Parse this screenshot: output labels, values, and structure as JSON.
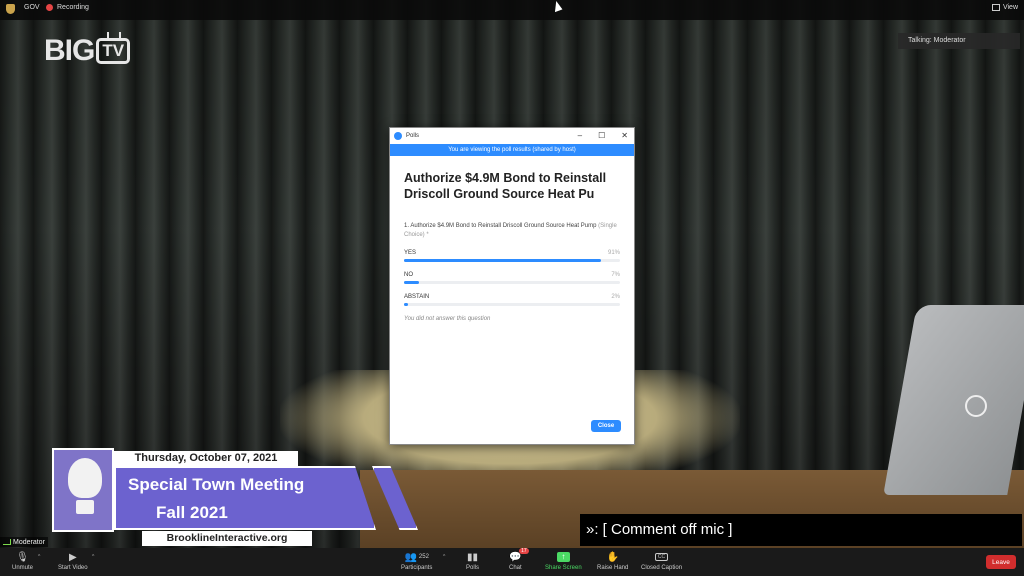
{
  "topbar": {
    "gov_label": "GOV",
    "recording_label": "Recording",
    "view_label": "View"
  },
  "logo": {
    "big": "BIG",
    "tv": "TV"
  },
  "talking": "Talking: Moderator",
  "poll": {
    "window_title": "Polls",
    "banner": "You are viewing the poll results (shared by host)",
    "title": "Authorize $4.9M Bond to Reinstall Driscoll Ground Source Heat Pu",
    "question": "1. Authorize $4.9M Bond to Reinstall Driscoll Ground Source Heat Pump",
    "question_type": "(Single Choice) *",
    "options": [
      {
        "label": "YES",
        "percent_label": "91%",
        "percent": 91
      },
      {
        "label": "NO",
        "percent_label": "7%",
        "percent": 7
      },
      {
        "label": "ABSTAIN",
        "percent_label": "2%",
        "percent": 2
      }
    ],
    "no_answer": "You did not answer this question",
    "close_label": "Close",
    "accent_color": "#2d8cff"
  },
  "lower_third": {
    "date": "Thursday, October 07, 2021",
    "title_line1": "Special Town Meeting",
    "title_line2": "Fall 2021",
    "url": "BrooklineInteractive.org",
    "accent_color": "#6c62cf"
  },
  "caption": "»:  [ Comment off mic ]",
  "speaker_tag": "Moderator",
  "toolbar": {
    "unmute": "Unmute",
    "start_video": "Start Video",
    "participants": "Participants",
    "participants_count": "252",
    "polls": "Polls",
    "chat": "Chat",
    "chat_badge": "17",
    "share_screen": "Share Screen",
    "raise_hand": "Raise Hand",
    "closed_caption": "Closed Caption",
    "cc_icon_text": "CC",
    "leave": "Leave"
  }
}
